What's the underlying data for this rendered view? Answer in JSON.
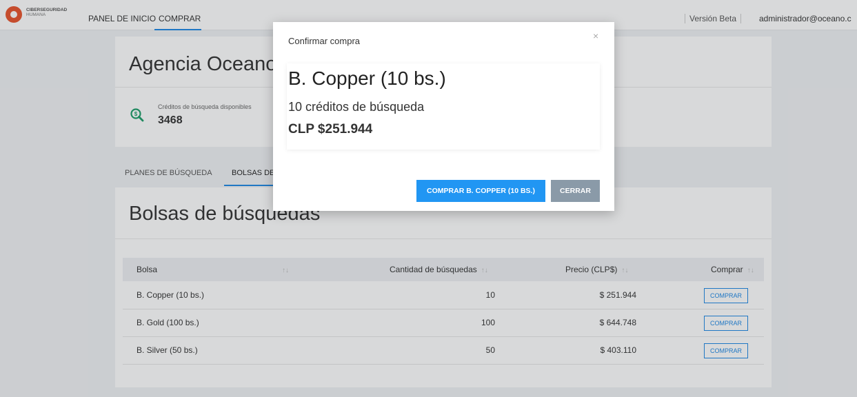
{
  "nav": {
    "brand_line1": "CIBERSEGURIDAD",
    "brand_line2": "HUMANA",
    "items": [
      {
        "label": "PANEL DE INICIO"
      },
      {
        "label": "COMPRAR"
      }
    ],
    "version": "Versión Beta",
    "user": "administrador@oceano.c"
  },
  "agency": {
    "title": "Agencia Oceano",
    "credits_label": "Créditos de búsqueda disponibles",
    "credits_value": "3468"
  },
  "tabs": [
    {
      "label": "PLANES DE BÚSQUEDA"
    },
    {
      "label": "BOLSAS DE BÚSQUEDAS"
    }
  ],
  "bolsas": {
    "title": "Bolsas de búsquedas",
    "columns": [
      "Bolsa",
      "Cantidad de búsquedas",
      "Precio (CLP$)",
      "Comprar"
    ],
    "sort_glyph": "↑↓",
    "rows": [
      {
        "name": "B. Copper (10 bs.)",
        "qty": "10",
        "price": "$ 251.944",
        "action": "COMPRAR"
      },
      {
        "name": "B. Gold (100 bs.)",
        "qty": "100",
        "price": "$ 644.748",
        "action": "COMPRAR"
      },
      {
        "name": "B. Silver (50 bs.)",
        "qty": "50",
        "price": "$ 403.110",
        "action": "COMPRAR"
      }
    ]
  },
  "modal": {
    "title": "Confirmar compra",
    "close_glyph": "×",
    "product_name": "B. Copper (10 bs.)",
    "credits": "10 créditos de búsqueda",
    "price": "CLP $251.944",
    "confirm_label": "COMPRAR B. COPPER (10 BS.)",
    "cancel_label": "CERRAR"
  },
  "colors": {
    "accent": "#2196f3",
    "brand": "#e8542c",
    "icon_green": "#1e9e6a"
  }
}
